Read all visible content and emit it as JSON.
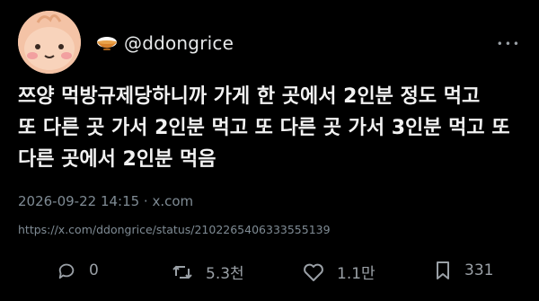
{
  "header": {
    "handle": "@ddongrice"
  },
  "post": {
    "text": "쯔양 먹방규제당하니까 가게 한 곳에서 2인분 정도 먹고\n또 다른 곳 가서 2인분 먹고 또 다른 곳 가서 3인분 먹고 또\n다른 곳에서 2인분 먹음",
    "timestamp": "2026-09-22 14:15 · x.com",
    "url": "https://x.com/ddongrice/status/2102265406333555139"
  },
  "actions": {
    "replies": "0",
    "reposts": "5.3천",
    "likes": "1.1만",
    "bookmarks": "331"
  }
}
